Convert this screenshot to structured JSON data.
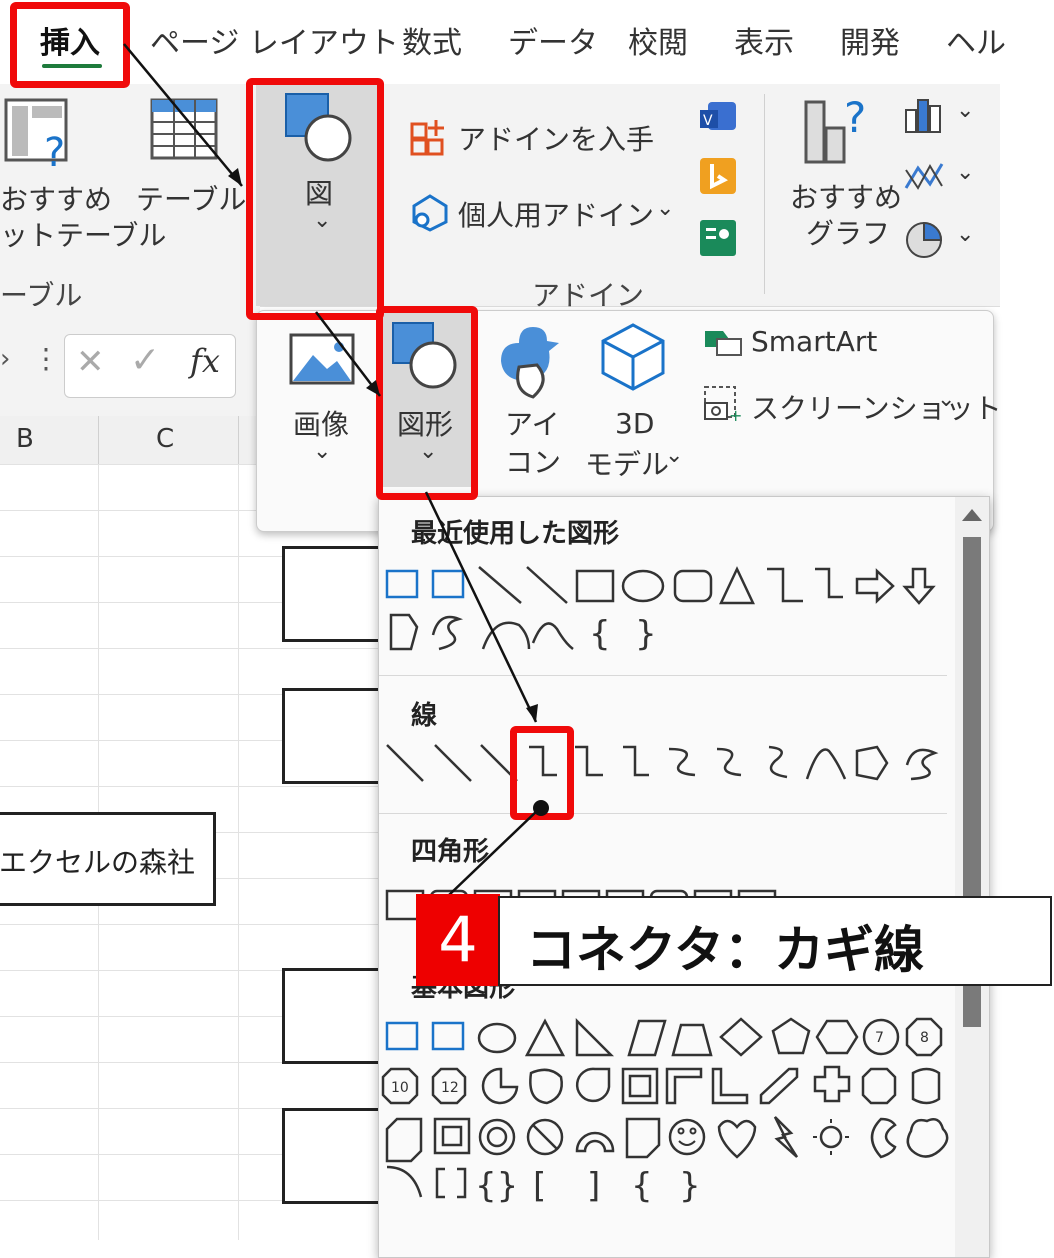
{
  "tabs": [
    "挿入",
    "ページ レイアウト",
    "数式",
    "データ",
    "校閲",
    "表示",
    "開発",
    "ヘル"
  ],
  "ribbon": {
    "pivot_label_1": "おすすめ",
    "pivot_label_2": "ットテーブル",
    "table_label": "テーブル",
    "table_group": "ーブル",
    "illustrations_label": "図",
    "get_addins": "アドインを入手",
    "personal_addins": "個人用アドイン",
    "addins_group": "アドイン",
    "rec_chart_1": "おすすめ",
    "rec_chart_2": "グラフ"
  },
  "formula_bar": {
    "fx": "fx"
  },
  "columns": [
    "B",
    "C"
  ],
  "sheet": {
    "company_cell": "エクセルの森社"
  },
  "image_menu": {
    "pictures": "画像",
    "shapes": "図形",
    "icons_1": "アイ",
    "icons_2": "コン",
    "model_1": "3D",
    "model_2": "モデル",
    "smartart": "SmartArt",
    "screenshot": "スクリーンショット"
  },
  "gallery": {
    "recent": "最近使用した図形",
    "lines": "線",
    "rectangles": "四角形",
    "basic": "基本図形"
  },
  "callout": {
    "number": "4",
    "text": "コネクタ：カギ線"
  },
  "colors": {
    "highlight": "#f00a0a",
    "accent": "#1e7b3c",
    "shape_blue": "#1a73c9"
  }
}
